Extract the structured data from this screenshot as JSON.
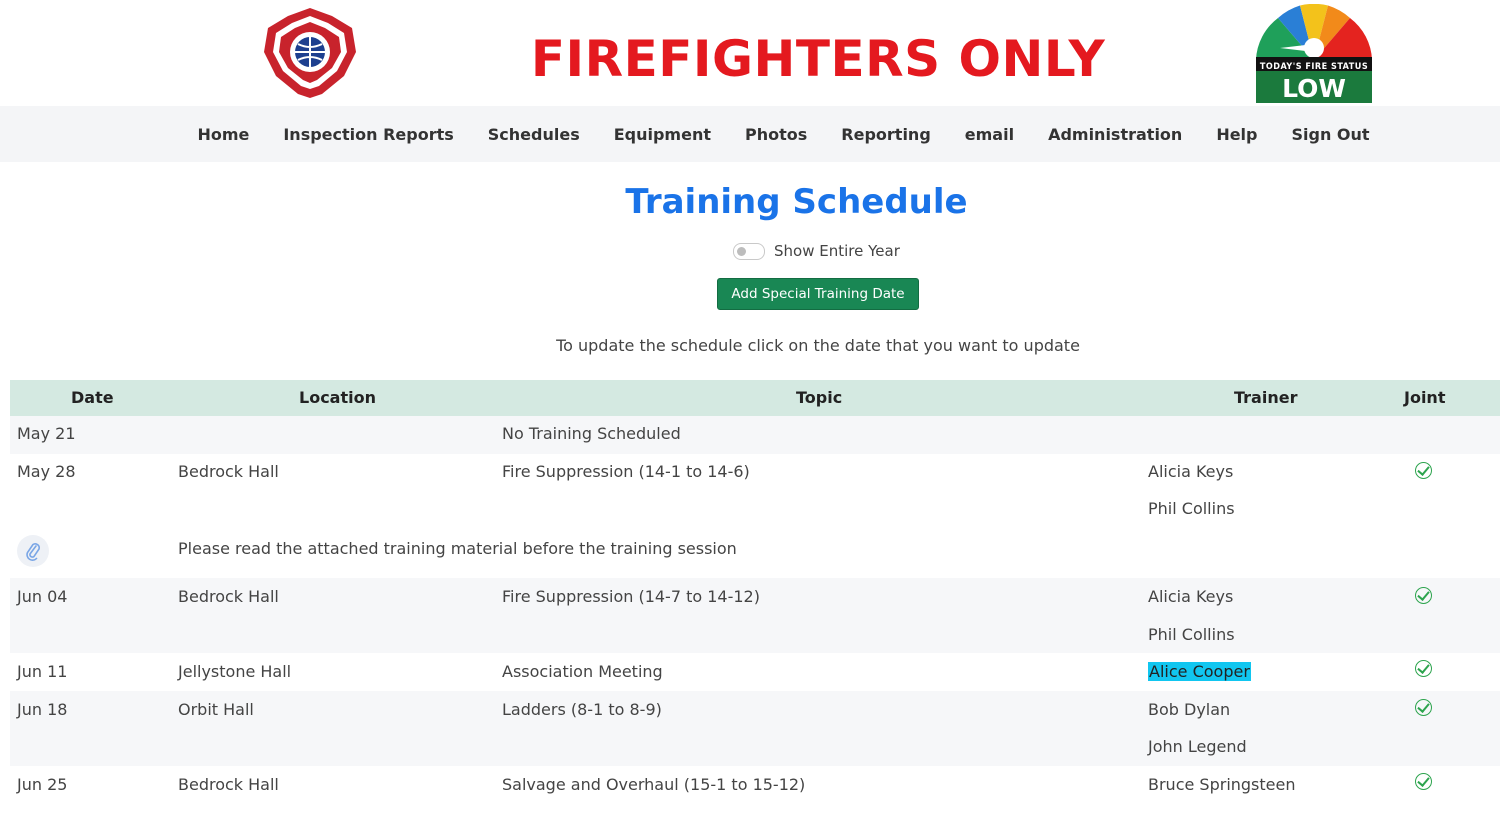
{
  "header": {
    "site_title": "FIREFIGHTERS ONLY",
    "fire_status": {
      "label": "TODAY'S FIRE STATUS",
      "value": "LOW"
    }
  },
  "nav": {
    "items": [
      "Home",
      "Inspection Reports",
      "Schedules",
      "Equipment",
      "Photos",
      "Reporting",
      "email",
      "Administration",
      "Help",
      "Sign Out"
    ]
  },
  "page": {
    "title": "Training Schedule",
    "toggle_label": "Show Entire Year",
    "add_button": "Add Special Training Date",
    "instructions": "To update the schedule click on the date that you want to update"
  },
  "table": {
    "headers": [
      "Date",
      "Location",
      "Topic",
      "Trainer",
      "Joint"
    ],
    "rows": [
      {
        "date": "May 21",
        "location": "",
        "topic": "No Training Scheduled",
        "trainers": [],
        "joint": false
      },
      {
        "date": "May 28",
        "location": "Bedrock Hall",
        "topic": "Fire Suppression (14-1 to 14-6)",
        "trainers": [
          "Alicia Keys",
          "Phil Collins"
        ],
        "joint": true,
        "note": "Please read the attached training material before the training session"
      },
      {
        "date": "Jun 04",
        "location": "Bedrock Hall",
        "topic": "Fire Suppression (14-7 to 14-12)",
        "trainers": [
          "Alicia Keys",
          "Phil Collins"
        ],
        "joint": true
      },
      {
        "date": "Jun 11",
        "location": "Jellystone Hall",
        "topic": "Association Meeting",
        "trainers": [
          "Alice Cooper"
        ],
        "joint": true
      },
      {
        "date": "Jun 18",
        "location": "Orbit Hall",
        "topic": "Ladders (8-1 to 8-9)",
        "trainers": [
          "Bob Dylan",
          "John Legend"
        ],
        "joint": true
      },
      {
        "date": "Jun 25",
        "location": "Bedrock Hall",
        "topic": "Salvage and Overhaul (15-1 to 15-12)",
        "trainers": [
          "Bruce Springsteen"
        ],
        "joint": true
      }
    ]
  },
  "colors": {
    "brand_red": "#e4191f",
    "title_blue": "#1a73e8",
    "button_green": "#198754",
    "header_row": "#d4e9e1",
    "highlight": "#11c6f0",
    "check_green": "#2da44e"
  }
}
